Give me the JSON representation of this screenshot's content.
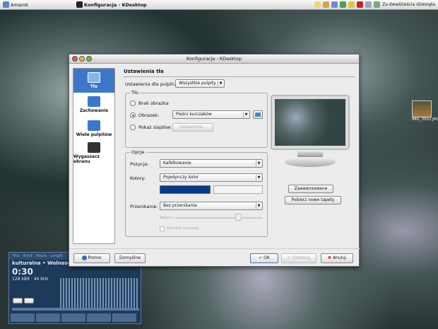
{
  "taskbar": {
    "items": [
      {
        "label": "Amarok",
        "icon": "amarok-icon"
      },
      {
        "label": "Konfiguracja - KDesktop",
        "icon": "kde-icon"
      }
    ],
    "clock": "Za dwadzieścia dziesiąta"
  },
  "window": {
    "title": "Konfiguracja - KDesktop"
  },
  "sidebar": {
    "items": [
      {
        "label": "Tło"
      },
      {
        "label": "Zachowanie"
      },
      {
        "label": "Wiele pulpitów"
      },
      {
        "label": "Wygaszacz ekranu"
      }
    ]
  },
  "section_title": "Ustawienia tła",
  "desktop_settings": {
    "label": "Ustawienia dla pulpitu:",
    "value": "Wszystkie pulpity"
  },
  "background_group": {
    "title": "Tło",
    "no_image": "Brak obrazka",
    "image": "Obrazek:",
    "image_value": "Pieśni kurczaków",
    "slideshow": "Pokaz slajdów:",
    "settings_button": "Ustawienia..."
  },
  "options_group": {
    "title": "Opcje",
    "position_label": "Pozycja:",
    "position_value": "Kafelkowanie",
    "colors_label": "Kolory:",
    "colors_value": "Pojedynczy kolor",
    "blend_label": "Przenikanie:",
    "blend_value": "Bez przenikania",
    "balance_label": "Balans:",
    "reverse_roles": "Zamień warstwy"
  },
  "right_buttons": {
    "advanced": "Zaawansowane",
    "get_new": "Pobierz nowe tapety"
  },
  "footer": {
    "help": "Pomoc",
    "defaults": "Domyślne",
    "ok": "OK",
    "apply": "Zastosuj",
    "cancel": "Anuluj"
  },
  "desktop_icon": {
    "label": "IMG_3502.JPG"
  },
  "player": {
    "header": "Title · Artist · Album · Length",
    "ticker": "kulturalna • Wolnosc slowa • 2:57 • Pudel",
    "time": "0:30",
    "bitrate": "128 kBit · 44 kHz",
    "pl": "PL",
    "eq": "EQ"
  },
  "colors": {
    "accent": "#3d78c8",
    "color_swatch": "#0a3a8a"
  }
}
